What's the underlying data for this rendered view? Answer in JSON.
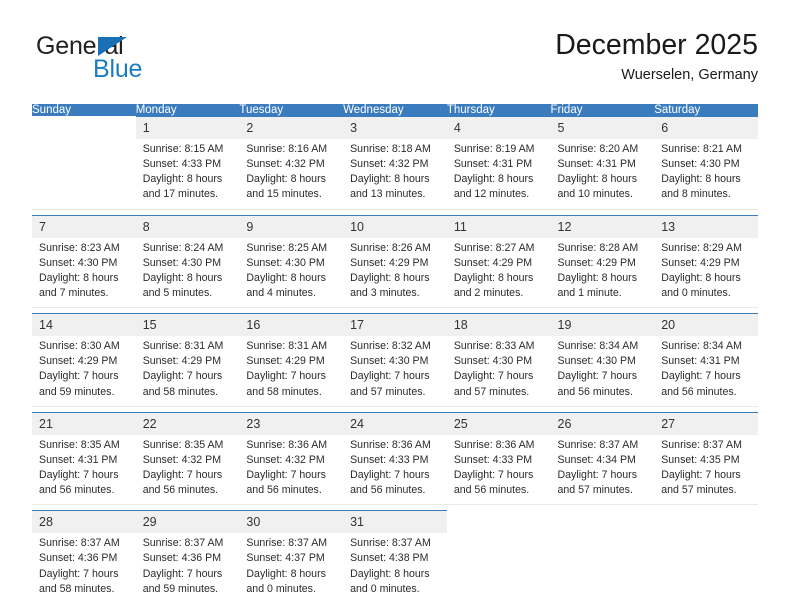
{
  "brand": {
    "word_general": "General",
    "word_blue": "Blue",
    "accent_color": "#1a7dc4"
  },
  "header": {
    "title": "December 2025",
    "subtitle": "Wuerselen, Germany"
  },
  "calendar": {
    "header_bg": "#3b7cbe",
    "daynum_bg": "#f0f0f0",
    "weekdays": [
      "Sunday",
      "Monday",
      "Tuesday",
      "Wednesday",
      "Thursday",
      "Friday",
      "Saturday"
    ],
    "weeks": [
      [
        {
          "day": "",
          "sunrise": "",
          "sunset": "",
          "daylight1": "",
          "daylight2": ""
        },
        {
          "day": "1",
          "sunrise": "Sunrise: 8:15 AM",
          "sunset": "Sunset: 4:33 PM",
          "daylight1": "Daylight: 8 hours",
          "daylight2": "and 17 minutes."
        },
        {
          "day": "2",
          "sunrise": "Sunrise: 8:16 AM",
          "sunset": "Sunset: 4:32 PM",
          "daylight1": "Daylight: 8 hours",
          "daylight2": "and 15 minutes."
        },
        {
          "day": "3",
          "sunrise": "Sunrise: 8:18 AM",
          "sunset": "Sunset: 4:32 PM",
          "daylight1": "Daylight: 8 hours",
          "daylight2": "and 13 minutes."
        },
        {
          "day": "4",
          "sunrise": "Sunrise: 8:19 AM",
          "sunset": "Sunset: 4:31 PM",
          "daylight1": "Daylight: 8 hours",
          "daylight2": "and 12 minutes."
        },
        {
          "day": "5",
          "sunrise": "Sunrise: 8:20 AM",
          "sunset": "Sunset: 4:31 PM",
          "daylight1": "Daylight: 8 hours",
          "daylight2": "and 10 minutes."
        },
        {
          "day": "6",
          "sunrise": "Sunrise: 8:21 AM",
          "sunset": "Sunset: 4:30 PM",
          "daylight1": "Daylight: 8 hours",
          "daylight2": "and 8 minutes."
        }
      ],
      [
        {
          "day": "7",
          "sunrise": "Sunrise: 8:23 AM",
          "sunset": "Sunset: 4:30 PM",
          "daylight1": "Daylight: 8 hours",
          "daylight2": "and 7 minutes."
        },
        {
          "day": "8",
          "sunrise": "Sunrise: 8:24 AM",
          "sunset": "Sunset: 4:30 PM",
          "daylight1": "Daylight: 8 hours",
          "daylight2": "and 5 minutes."
        },
        {
          "day": "9",
          "sunrise": "Sunrise: 8:25 AM",
          "sunset": "Sunset: 4:30 PM",
          "daylight1": "Daylight: 8 hours",
          "daylight2": "and 4 minutes."
        },
        {
          "day": "10",
          "sunrise": "Sunrise: 8:26 AM",
          "sunset": "Sunset: 4:29 PM",
          "daylight1": "Daylight: 8 hours",
          "daylight2": "and 3 minutes."
        },
        {
          "day": "11",
          "sunrise": "Sunrise: 8:27 AM",
          "sunset": "Sunset: 4:29 PM",
          "daylight1": "Daylight: 8 hours",
          "daylight2": "and 2 minutes."
        },
        {
          "day": "12",
          "sunrise": "Sunrise: 8:28 AM",
          "sunset": "Sunset: 4:29 PM",
          "daylight1": "Daylight: 8 hours",
          "daylight2": "and 1 minute."
        },
        {
          "day": "13",
          "sunrise": "Sunrise: 8:29 AM",
          "sunset": "Sunset: 4:29 PM",
          "daylight1": "Daylight: 8 hours",
          "daylight2": "and 0 minutes."
        }
      ],
      [
        {
          "day": "14",
          "sunrise": "Sunrise: 8:30 AM",
          "sunset": "Sunset: 4:29 PM",
          "daylight1": "Daylight: 7 hours",
          "daylight2": "and 59 minutes."
        },
        {
          "day": "15",
          "sunrise": "Sunrise: 8:31 AM",
          "sunset": "Sunset: 4:29 PM",
          "daylight1": "Daylight: 7 hours",
          "daylight2": "and 58 minutes."
        },
        {
          "day": "16",
          "sunrise": "Sunrise: 8:31 AM",
          "sunset": "Sunset: 4:29 PM",
          "daylight1": "Daylight: 7 hours",
          "daylight2": "and 58 minutes."
        },
        {
          "day": "17",
          "sunrise": "Sunrise: 8:32 AM",
          "sunset": "Sunset: 4:30 PM",
          "daylight1": "Daylight: 7 hours",
          "daylight2": "and 57 minutes."
        },
        {
          "day": "18",
          "sunrise": "Sunrise: 8:33 AM",
          "sunset": "Sunset: 4:30 PM",
          "daylight1": "Daylight: 7 hours",
          "daylight2": "and 57 minutes."
        },
        {
          "day": "19",
          "sunrise": "Sunrise: 8:34 AM",
          "sunset": "Sunset: 4:30 PM",
          "daylight1": "Daylight: 7 hours",
          "daylight2": "and 56 minutes."
        },
        {
          "day": "20",
          "sunrise": "Sunrise: 8:34 AM",
          "sunset": "Sunset: 4:31 PM",
          "daylight1": "Daylight: 7 hours",
          "daylight2": "and 56 minutes."
        }
      ],
      [
        {
          "day": "21",
          "sunrise": "Sunrise: 8:35 AM",
          "sunset": "Sunset: 4:31 PM",
          "daylight1": "Daylight: 7 hours",
          "daylight2": "and 56 minutes."
        },
        {
          "day": "22",
          "sunrise": "Sunrise: 8:35 AM",
          "sunset": "Sunset: 4:32 PM",
          "daylight1": "Daylight: 7 hours",
          "daylight2": "and 56 minutes."
        },
        {
          "day": "23",
          "sunrise": "Sunrise: 8:36 AM",
          "sunset": "Sunset: 4:32 PM",
          "daylight1": "Daylight: 7 hours",
          "daylight2": "and 56 minutes."
        },
        {
          "day": "24",
          "sunrise": "Sunrise: 8:36 AM",
          "sunset": "Sunset: 4:33 PM",
          "daylight1": "Daylight: 7 hours",
          "daylight2": "and 56 minutes."
        },
        {
          "day": "25",
          "sunrise": "Sunrise: 8:36 AM",
          "sunset": "Sunset: 4:33 PM",
          "daylight1": "Daylight: 7 hours",
          "daylight2": "and 56 minutes."
        },
        {
          "day": "26",
          "sunrise": "Sunrise: 8:37 AM",
          "sunset": "Sunset: 4:34 PM",
          "daylight1": "Daylight: 7 hours",
          "daylight2": "and 57 minutes."
        },
        {
          "day": "27",
          "sunrise": "Sunrise: 8:37 AM",
          "sunset": "Sunset: 4:35 PM",
          "daylight1": "Daylight: 7 hours",
          "daylight2": "and 57 minutes."
        }
      ],
      [
        {
          "day": "28",
          "sunrise": "Sunrise: 8:37 AM",
          "sunset": "Sunset: 4:36 PM",
          "daylight1": "Daylight: 7 hours",
          "daylight2": "and 58 minutes."
        },
        {
          "day": "29",
          "sunrise": "Sunrise: 8:37 AM",
          "sunset": "Sunset: 4:36 PM",
          "daylight1": "Daylight: 7 hours",
          "daylight2": "and 59 minutes."
        },
        {
          "day": "30",
          "sunrise": "Sunrise: 8:37 AM",
          "sunset": "Sunset: 4:37 PM",
          "daylight1": "Daylight: 8 hours",
          "daylight2": "and 0 minutes."
        },
        {
          "day": "31",
          "sunrise": "Sunrise: 8:37 AM",
          "sunset": "Sunset: 4:38 PM",
          "daylight1": "Daylight: 8 hours",
          "daylight2": "and 0 minutes."
        },
        {
          "day": "",
          "sunrise": "",
          "sunset": "",
          "daylight1": "",
          "daylight2": ""
        },
        {
          "day": "",
          "sunrise": "",
          "sunset": "",
          "daylight1": "",
          "daylight2": ""
        },
        {
          "day": "",
          "sunrise": "",
          "sunset": "",
          "daylight1": "",
          "daylight2": ""
        }
      ]
    ]
  }
}
